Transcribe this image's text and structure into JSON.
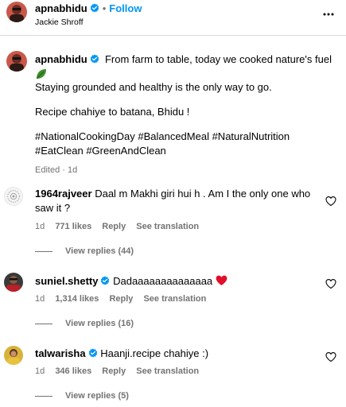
{
  "header": {
    "username": "apnabhidu",
    "follow_label": "Follow",
    "subtitle": "Jackie Shroff"
  },
  "caption": {
    "username": "apnabhidu",
    "line1": "From farm to table, today we cooked nature's fuel",
    "line2": "Staying grounded and healthy is the only way to go.",
    "line3": "Recipe chahiye to batana, Bhidu !",
    "hashtags1": "#NationalCookingDay #BalancedMeal #NaturalNutrition",
    "hashtags2": "#EatClean #GreenAndClean",
    "meta": "Edited · 1d"
  },
  "comments": [
    {
      "username": "1964rajveer",
      "text": "Daal m Makhi giri hui h . Am I the only one who saw it ?",
      "time": "1d",
      "likes": "771 likes",
      "reply_label": "Reply",
      "translate_label": "See translation",
      "view_replies": "View replies (44)"
    },
    {
      "username": "suniel.shetty",
      "text": "Dadaaaaaaaaaaaaaa",
      "time": "1d",
      "likes": "1,314 likes",
      "reply_label": "Reply",
      "translate_label": "See translation",
      "view_replies": "View replies (16)"
    },
    {
      "username": "talwarisha",
      "text": "Haanji.recipe chahiye :)",
      "time": "1d",
      "likes": "346 likes",
      "reply_label": "Reply",
      "translate_label": "See translation",
      "view_replies": "View replies (5)"
    }
  ],
  "colors": {
    "link_blue": "#0095f6",
    "verified_blue": "#0095f6",
    "secondary_text": "#737373",
    "divider": "#dbdbdb",
    "heart_red": "#e0102a",
    "leaf_green": "#3f8f2d"
  },
  "icons": {
    "verified": "verified-badge-icon",
    "more": "more-options-icon",
    "like": "heart-outline-icon",
    "red_heart": "red-heart-emoji-icon",
    "leaf": "leaf-emoji-icon"
  }
}
